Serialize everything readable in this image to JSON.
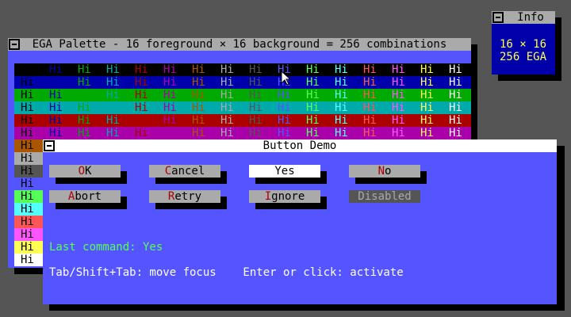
{
  "palette_window": {
    "title": "EGA Palette - 16 foreground × 16 background = 256 combinations",
    "cell_text": "Hi",
    "colors": [
      "#000000",
      "#0000AA",
      "#00AA00",
      "#00AAAA",
      "#AA0000",
      "#AA00AA",
      "#AA5500",
      "#AAAAAA",
      "#555555",
      "#5555FF",
      "#55FF55",
      "#55FFFF",
      "#FF5555",
      "#FF55FF",
      "#FFFF55",
      "#FFFFFF"
    ]
  },
  "info_window": {
    "title": "Info",
    "line1": "16 × 16",
    "line2": "256 EGA"
  },
  "button_dialog": {
    "title": "Button Demo",
    "buttons": [
      {
        "label": "OK",
        "hot": 0,
        "state": "normal"
      },
      {
        "label": "Cancel",
        "hot": 0,
        "state": "normal"
      },
      {
        "label": "Yes",
        "hot": -1,
        "state": "focused"
      },
      {
        "label": "No",
        "hot": 0,
        "state": "normal"
      },
      {
        "label": "Abort",
        "hot": 0,
        "state": "normal"
      },
      {
        "label": "Retry",
        "hot": 0,
        "state": "normal"
      },
      {
        "label": "Ignore",
        "hot": 0,
        "state": "normal"
      },
      {
        "label": "Disabled",
        "hot": -1,
        "state": "disabled"
      }
    ],
    "last_command": "Last command: Yes",
    "help_text": "Tab/Shift+Tab: move focus    Enter or click: activate"
  },
  "colors": {
    "desktop": "#555555",
    "dialog_bg": "#5555FF",
    "green_text": "#55FF55",
    "hotkey": "#AA0000",
    "info_text": "#FFFF55"
  }
}
